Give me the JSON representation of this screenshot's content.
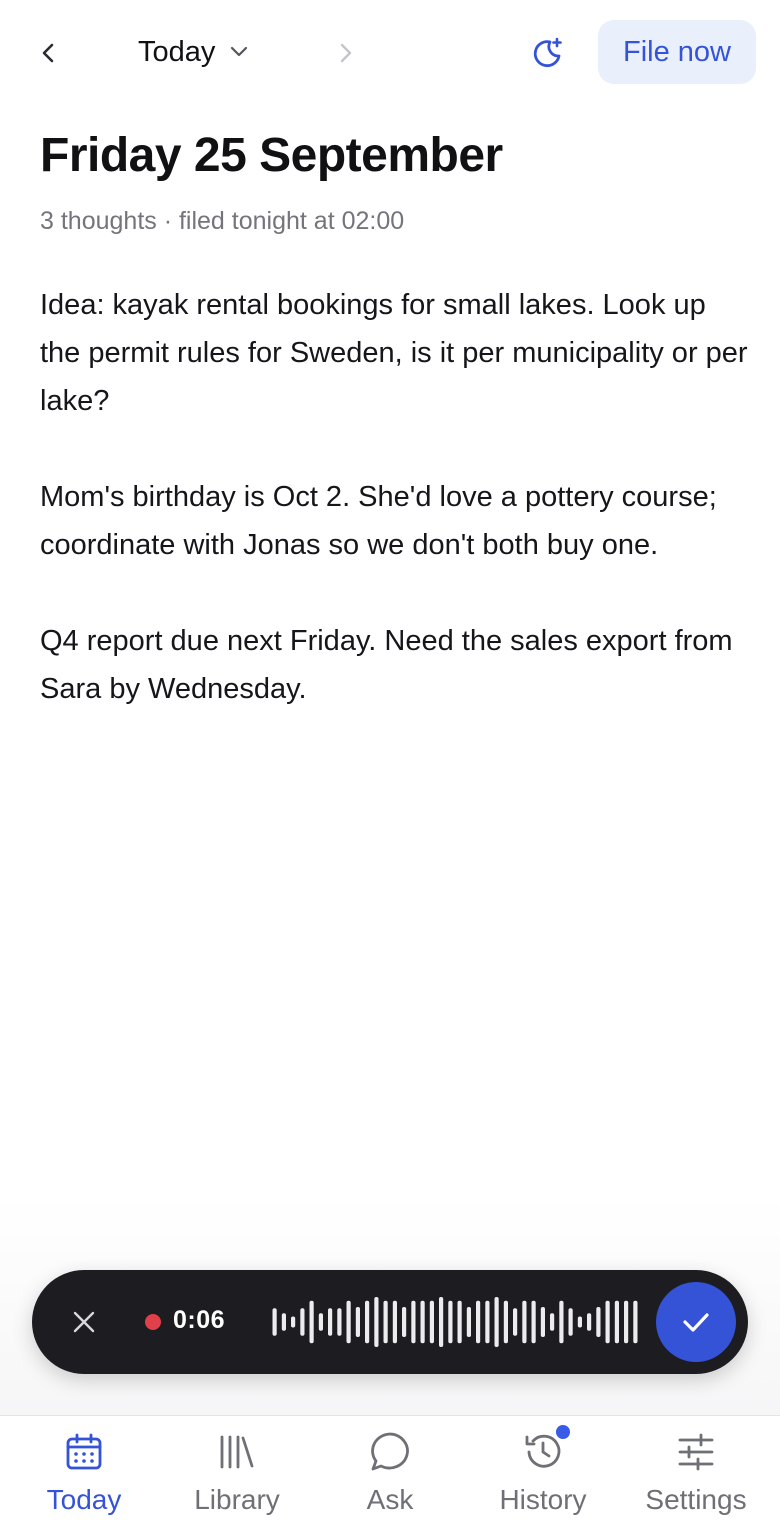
{
  "header": {
    "back_icon": "chevron-left-icon",
    "date_picker_label": "Today",
    "date_picker_icon": "chevron-down-icon",
    "forward_icon": "chevron-right-icon",
    "moon_icon": "moon-sparkle-icon",
    "file_now_label": "File now"
  },
  "day": {
    "title": "Friday 25 September",
    "meta": "3 thoughts · filed tonight at 02:00"
  },
  "notes": [
    "Idea: kayak rental bookings for small lakes. Look up the permit rules for Sweden, is it per municipality or per lake?",
    "Mom's birthday is Oct 2. She'd love a pottery course; coordinate with Jonas so we don't both buy one.",
    "Q4 report due next Friday. Need the sales export from Sara by Wednesday."
  ],
  "recorder": {
    "elapsed": "0:06",
    "recording_color": "#e0404a",
    "waveform_levels": [
      0.55,
      0.35,
      0.22,
      0.55,
      0.85,
      0.35,
      0.55,
      0.55,
      0.85,
      0.6,
      0.85,
      1.0,
      0.85,
      0.85,
      0.6,
      0.85,
      0.85,
      0.85,
      1.0,
      0.85,
      0.85,
      0.6,
      0.85,
      0.85,
      1.0,
      0.85,
      0.55,
      0.85,
      0.85,
      0.6,
      0.35,
      0.85,
      0.55,
      0.22,
      0.35,
      0.6,
      0.85,
      0.85,
      0.85,
      0.85
    ],
    "cancel_icon": "close-icon",
    "confirm_icon": "checkmark-icon"
  },
  "tabs": [
    {
      "label": "Today",
      "icon": "calendar-icon",
      "active": true
    },
    {
      "label": "Library",
      "icon": "library-icon",
      "active": false
    },
    {
      "label": "Ask",
      "icon": "chat-bubble-icon",
      "active": false
    },
    {
      "label": "History",
      "icon": "history-icon",
      "active": false,
      "badge": true
    },
    {
      "label": "Settings",
      "icon": "sliders-icon",
      "active": false
    }
  ],
  "colors": {
    "accent": "#3553d6",
    "accent_soft": "#eaeffc",
    "recorder_bg": "#1c1c21",
    "text_primary": "#111114",
    "text_secondary": "#74747c",
    "tab_inactive": "#6f6f76"
  }
}
